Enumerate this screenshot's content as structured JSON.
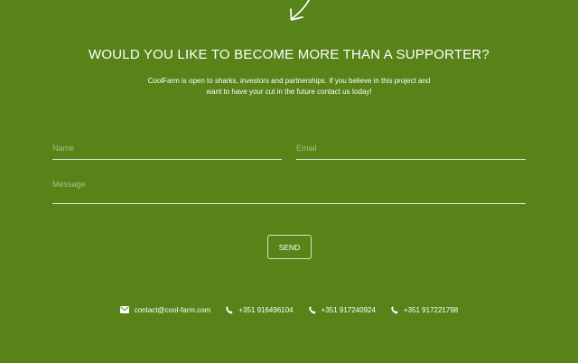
{
  "icons": {
    "top": "arrow-icon",
    "email": "envelope-icon",
    "phone": "phone-icon"
  },
  "headline": "WOULD YOU LIKE TO BECOME MORE THAN A SUPPORTER?",
  "intro": {
    "line1": "CoolFarm is open to sharks, investors and partnerships. If you believe in this project and",
    "line2": "want to have your cut in the future contact us today!"
  },
  "form": {
    "name_placeholder": "Name",
    "email_placeholder": "Email",
    "message_placeholder": "Message",
    "send_label": "SEND"
  },
  "contact": {
    "email": "contact@cool-farm.com",
    "phones": [
      "+351 916496104",
      "+351 917240924",
      "+351 917221798"
    ]
  },
  "colors": {
    "background": "#578319",
    "text": "#ffffff",
    "placeholder": "#a7c27f"
  }
}
